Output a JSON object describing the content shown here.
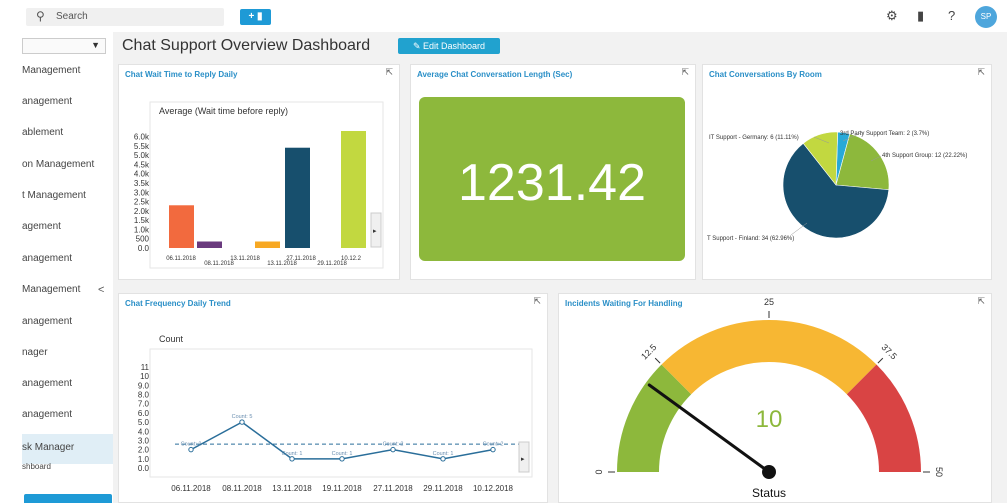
{
  "topbar": {
    "search_placeholder": "Search",
    "search_icon": "search-icon",
    "add_label": "+ ▮",
    "settings_icon": "gear-icon",
    "folder_icon": "folder-icon",
    "help_label": "?",
    "avatar_initials": "SP"
  },
  "sidebar": {
    "items": [
      {
        "label": "Management"
      },
      {
        "label": "anagement"
      },
      {
        "label": "ablement"
      },
      {
        "label": "on Management"
      },
      {
        "label": "t Management"
      },
      {
        "label": "agement"
      },
      {
        "label": "anagement"
      },
      {
        "label": "Management"
      },
      {
        "label": "anagement"
      },
      {
        "label": "nager"
      },
      {
        "label": "anagement"
      },
      {
        "label": "anagement"
      },
      {
        "label": "sk Manager"
      },
      {
        "label": "shboard"
      }
    ],
    "collapse_label": "<"
  },
  "page": {
    "title": "Chat Support Overview Dashboard",
    "edit_label": "✎ Edit Dashboard"
  },
  "panels": {
    "wait_time": {
      "title": "Chat Wait Time to Reply Daily"
    },
    "avg_length": {
      "title": "Average Chat Conversation Length (Sec)",
      "value": "1231.42",
      "color": "#8db83c"
    },
    "by_room": {
      "title": "Chat Conversations By Room"
    },
    "frequency": {
      "title": "Chat Frequency Daily Trend"
    },
    "incidents": {
      "title": "Incidents Waiting For Handling"
    }
  },
  "chart_data": [
    {
      "type": "bar",
      "title": "Average (Wait time before reply)",
      "categories": [
        "06.11.2018",
        "08.11.2018",
        "13.11.2018",
        "13.11.2018",
        "27.11.2018",
        "29.11.2018",
        "10.12.2"
      ],
      "values": [
        2300,
        350,
        0,
        350,
        5400,
        0,
        6300
      ],
      "colors": [
        "#f26a3e",
        "#6a3a7e",
        "#ffffff",
        "#f7a823",
        "#174f6d",
        "#ffffff",
        "#c2d840"
      ],
      "y_ticks": [
        "0.0",
        "500",
        "1.0k",
        "1.5k",
        "2.0k",
        "2.5k",
        "3.0k",
        "3.5k",
        "4.0k",
        "4.5k",
        "5.0k",
        "5.5k",
        "6.0k"
      ],
      "ylim": [
        0,
        6300
      ]
    },
    {
      "type": "pie",
      "slices": [
        {
          "label": "T Support - Finland: 34 (62.96%)",
          "value": 34,
          "color": "#174f6d"
        },
        {
          "label": "IT Support - Germany: 6 (11.11%)",
          "value": 6,
          "color": "#c2d840"
        },
        {
          "label": "3rd Party Support Team: 2 (3.7%)",
          "value": 2,
          "color": "#27a9d8"
        },
        {
          "label": "4th Support Group: 12 (22.22%)",
          "value": 12,
          "color": "#8db83c"
        }
      ]
    },
    {
      "type": "line",
      "title": "Count",
      "x": [
        "06.11.2018",
        "08.11.2018",
        "13.11.2018",
        "19.11.2018",
        "27.11.2018",
        "29.11.2018",
        "10.12.2018"
      ],
      "values": [
        2,
        5,
        1,
        1,
        2,
        1,
        2
      ],
      "point_labels": [
        "Count: 2",
        "Count: 5",
        "Count: 1",
        "Count: 1",
        "Count: 2",
        "Count: 1",
        "Count: 2"
      ],
      "y_ticks": [
        "0.0",
        "1.0",
        "2.0",
        "3.0",
        "4.0",
        "5.0",
        "6.0",
        "7.0",
        "8.0",
        "9.0",
        "10",
        "11"
      ],
      "ylim": [
        0,
        11
      ],
      "average": 2
    },
    {
      "type": "gauge",
      "value": 10,
      "min": 0,
      "max": 50,
      "ticks": [
        "0",
        "12.5",
        "25",
        "37.5",
        "50"
      ],
      "bands": [
        {
          "from": 0,
          "to": 12.5,
          "color": "#8db83c"
        },
        {
          "from": 12.5,
          "to": 25,
          "color": "#f7b733"
        },
        {
          "from": 25,
          "to": 37.5,
          "color": "#f7b733"
        },
        {
          "from": 37.5,
          "to": 50,
          "color": "#d94444"
        }
      ],
      "label": "Status",
      "value_color": "#8db83c"
    }
  ]
}
